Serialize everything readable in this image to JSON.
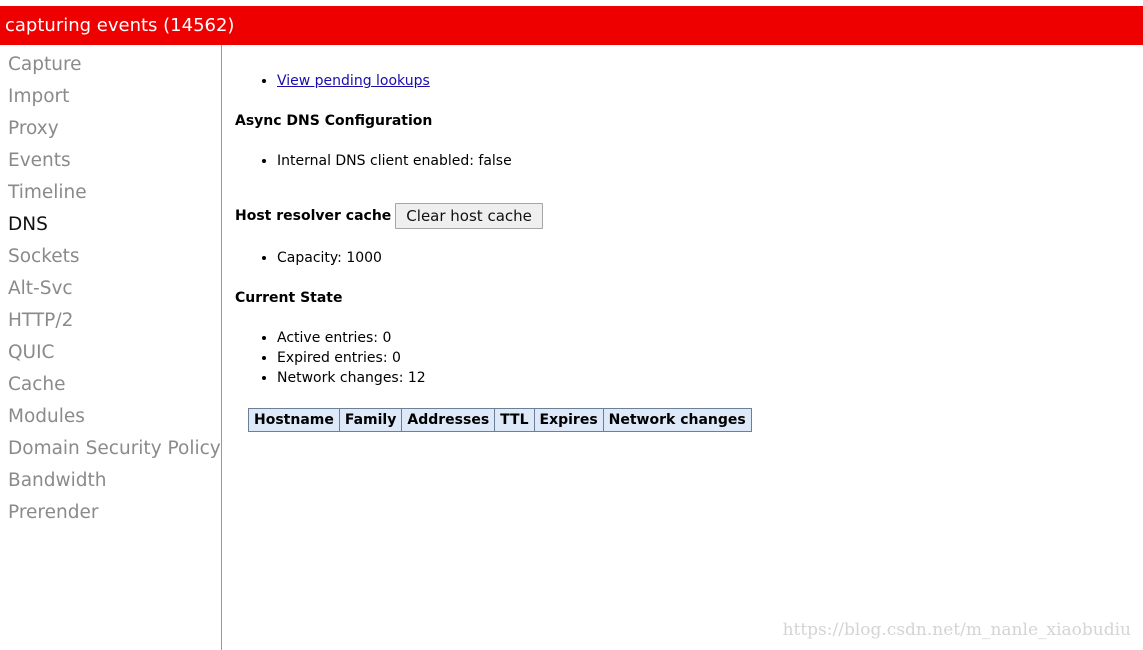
{
  "title_bar": {
    "text": "capturing events (14562)"
  },
  "sidebar": {
    "items": [
      {
        "label": "Capture",
        "selected": false
      },
      {
        "label": "Import",
        "selected": false
      },
      {
        "label": "Proxy",
        "selected": false
      },
      {
        "label": "Events",
        "selected": false
      },
      {
        "label": "Timeline",
        "selected": false
      },
      {
        "label": "DNS",
        "selected": true
      },
      {
        "label": "Sockets",
        "selected": false
      },
      {
        "label": "Alt-Svc",
        "selected": false
      },
      {
        "label": "HTTP/2",
        "selected": false
      },
      {
        "label": "QUIC",
        "selected": false
      },
      {
        "label": "Cache",
        "selected": false
      },
      {
        "label": "Modules",
        "selected": false
      },
      {
        "label": "Domain Security Policy",
        "selected": false
      },
      {
        "label": "Bandwidth",
        "selected": false
      },
      {
        "label": "Prerender",
        "selected": false
      }
    ]
  },
  "main": {
    "pending_link": "View pending lookups",
    "async_heading": "Async DNS Configuration",
    "internal_dns": "Internal DNS client enabled: false",
    "host_cache_heading": "Host resolver cache",
    "clear_button": "Clear host cache",
    "capacity": "Capacity: 1000",
    "current_state_heading": "Current State",
    "active_entries": "Active entries: 0",
    "expired_entries": "Expired entries: 0",
    "network_changes": "Network changes: 12",
    "table_headers": [
      "Hostname",
      "Family",
      "Addresses",
      "TTL",
      "Expires",
      "Network changes"
    ]
  },
  "watermark": "https://blog.csdn.net/m_nanle_xiaobudiu",
  "colors": {
    "title_bar": "#ee0000",
    "link": "#1a0dab",
    "table_header": "#dde8f8"
  }
}
